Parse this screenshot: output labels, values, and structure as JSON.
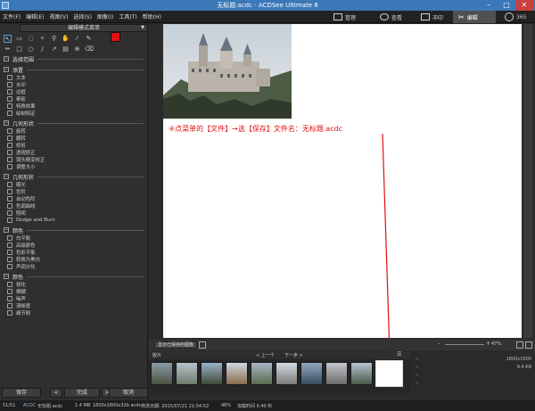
{
  "window": {
    "title": "无标题.acdc - ACDSee Ultimate 8",
    "minimize": "–",
    "maximize": "□",
    "close": "✕"
  },
  "menu": [
    "文件(F)",
    "编辑(E)",
    "视图(V)",
    "选择(S)",
    "图像(I)",
    "工具(T)",
    "帮助(H)"
  ],
  "mode_tabs": {
    "manage": "管理",
    "view": "查看",
    "develop": "冲印",
    "edit": "编辑",
    "online": "365"
  },
  "left_panel": {
    "mode_dropdown": "编辑模式菜单",
    "groups": [
      {
        "title": "选择范围",
        "items": []
      },
      {
        "title": "添置",
        "items": [
          "文本",
          "水印",
          "边框",
          "晕影",
          "特殊效果",
          "绘制特定"
        ]
      },
      {
        "title": "几何形状",
        "items": [
          "旋转",
          "翻转",
          "修剪",
          "透视修正",
          "镜头畸变校正",
          "调整大小"
        ]
      },
      {
        "title": "几何形状",
        "items": [
          "曝光",
          "色阶",
          "自动色阶",
          "色调曲线",
          "照明",
          "Dodge and Burn"
        ]
      },
      {
        "title": "颜色",
        "items": [
          "白平衡",
          "高级颜色",
          "色彩平衡",
          "转换为黑白",
          "声调分化"
        ]
      },
      {
        "title": "颜色",
        "items": [
          "锐化",
          "模糊",
          "噪声",
          "清晰度",
          "细节刷"
        ]
      }
    ],
    "buttons": {
      "save": "保存",
      "prev": "<",
      "done": "完成",
      "next": ">",
      "cancel": "取消"
    }
  },
  "canvas": {
    "instruction": "④点菜单的【文件】→选【保存】文件名：无标题.acdc"
  },
  "filmbar": {
    "show_selected": "显示已保存的图像",
    "zoom_minus": "–",
    "zoom_plus": "+",
    "zoom": "47%"
  },
  "filmstrip": {
    "label": "胶片",
    "prev": "< 上一个",
    "next": "下一步 >",
    "menu": "☰"
  },
  "info_panel": {
    "rows": [
      {
        "k": "--",
        "v": "1800x1600"
      },
      {
        "k": "--",
        "v": "9.4 KB"
      },
      {
        "k": "--",
        "v": ""
      },
      {
        "k": "--",
        "v": ""
      }
    ]
  },
  "status": {
    "count": "51/51",
    "format": "ACDC",
    "filename": "无标题.acdc",
    "size": "1.4 MB",
    "dims": "1800x1600x32b acdc",
    "modified": "修改日期: 2015/07/21 21:54:52",
    "zoom": "48%",
    "load_time": "加载时间 0.40 秒"
  },
  "colors": {
    "foreground": "#e01010",
    "background": "#f0e000",
    "titlebar": "#3a78b8",
    "annotation": "#e01010"
  }
}
